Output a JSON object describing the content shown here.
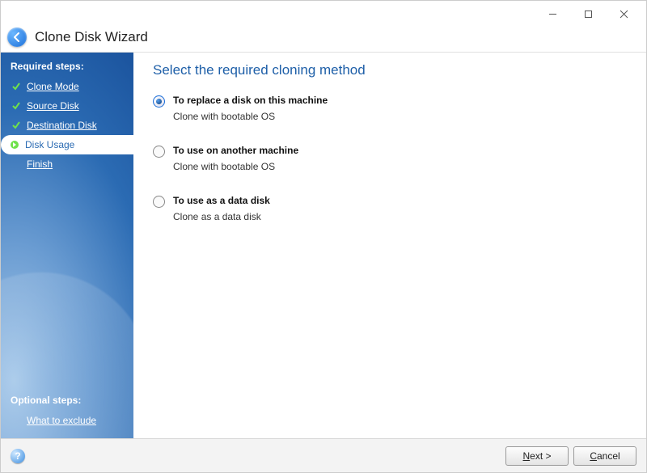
{
  "titlebar": {
    "minimize": "—",
    "maximize": "□",
    "close": "✕"
  },
  "header": {
    "title": "Clone Disk Wizard"
  },
  "sidebar": {
    "required_heading": "Required steps:",
    "optional_heading": "Optional steps:",
    "steps": [
      {
        "label": "Clone Mode",
        "state": "done"
      },
      {
        "label": "Source Disk",
        "state": "done"
      },
      {
        "label": "Destination Disk",
        "state": "done"
      },
      {
        "label": "Disk Usage",
        "state": "active"
      },
      {
        "label": "Finish",
        "state": "pending"
      }
    ],
    "optional": [
      {
        "label": "What to exclude"
      }
    ]
  },
  "content": {
    "title": "Select the required cloning method",
    "options": [
      {
        "title": "To replace a disk on this machine",
        "desc": "Clone with bootable OS",
        "selected": true
      },
      {
        "title": "To use on another machine",
        "desc": "Clone with bootable OS",
        "selected": false
      },
      {
        "title": "To use as a data disk",
        "desc": "Clone as a data disk",
        "selected": false
      }
    ]
  },
  "footer": {
    "next_prefix": "N",
    "next_rest": "ext >",
    "cancel_prefix": "C",
    "cancel_rest": "ancel",
    "help": "?"
  }
}
